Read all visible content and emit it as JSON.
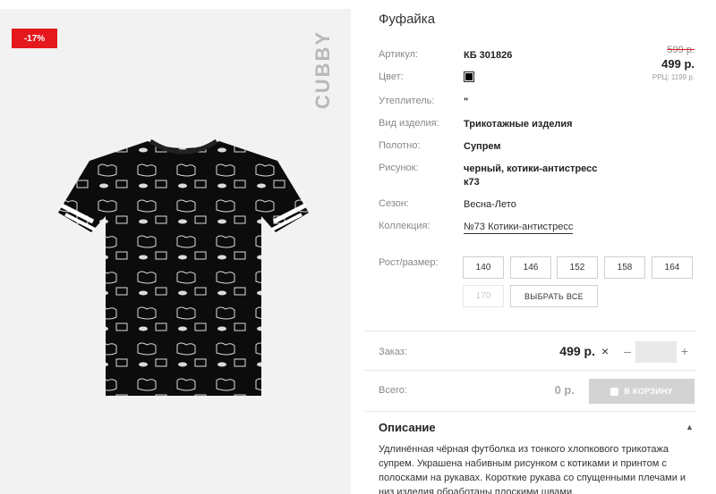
{
  "product": {
    "discount": "-17%",
    "brand": "CUBBY",
    "title": "Фуфайка",
    "old_price": "599 р.",
    "price": "499 р.",
    "rrc": "РРЦ: 1199 р."
  },
  "specs": {
    "article": {
      "label": "Артикул:",
      "value": "КБ 301826"
    },
    "color": {
      "label": "Цвет:",
      "value_color": "#000000"
    },
    "insulation": {
      "label": "Утеплитель:",
      "value": "\""
    },
    "type": {
      "label": "Вид изделия:",
      "value": "Трикотажные изделия"
    },
    "fabric": {
      "label": "Полотно:",
      "value": "Супрем"
    },
    "pattern": {
      "label": "Рисунок:",
      "value": "черный, котики-антистресс к73"
    },
    "season": {
      "label": "Сезон:",
      "value": "Весна-Лето"
    },
    "collection": {
      "label": "Коллекция:",
      "value": "№73 Котики-антистресс"
    }
  },
  "sizes": {
    "label": "Рост/размер:",
    "items": [
      "140",
      "146",
      "152",
      "158",
      "164",
      "170"
    ],
    "select_all": "ВЫБРАТЬ ВСЕ"
  },
  "order": {
    "label": "Заказ:",
    "price": "499 р.",
    "times": "×",
    "minus": "–",
    "plus": "+",
    "quantity": ""
  },
  "total": {
    "label": "Всего:",
    "value": "0 р.",
    "cart_button": "В КОРЗИНУ"
  },
  "description": {
    "title": "Описание",
    "toggle": "▲",
    "text": "Удлинённая чёрная футболка из тонкого хлопкового трикотажа супрем. Украшена набивным рисунком с котиками и принтом с полосками на рукавах. Короткие рукава со спущенными плечами и низ изделия обработаны плоскими швами."
  },
  "colors": {
    "accent_red": "#e4181d",
    "cart_disabled": "#d3d3d3"
  }
}
